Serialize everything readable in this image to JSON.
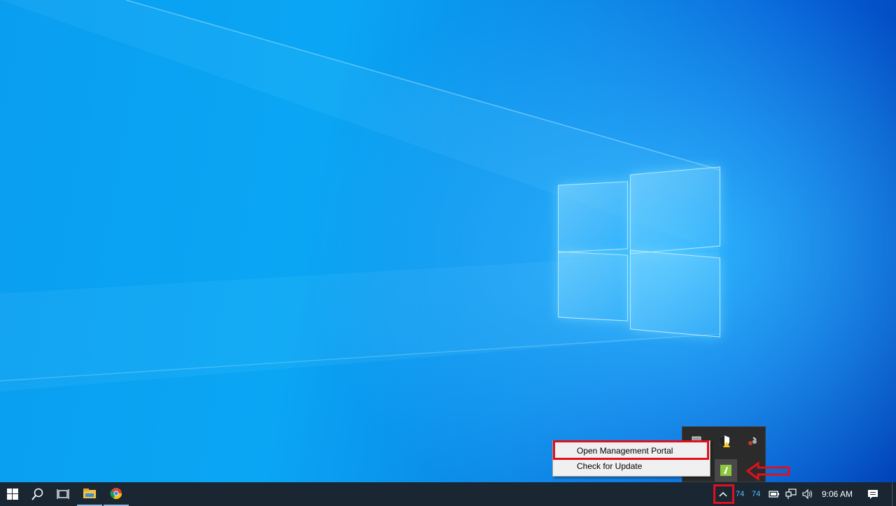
{
  "context_menu": {
    "items": [
      {
        "label": "Open Management Portal"
      },
      {
        "label": "Check for Update"
      }
    ]
  },
  "system_tray": {
    "cpu_temp": "74",
    "gpu_temp": "74",
    "clock": "9:06 AM"
  },
  "taskbar": {
    "pinned": [
      "windows-start-icon",
      "search-icon",
      "task-view-icon",
      "file-explorer-icon",
      "chrome-icon"
    ]
  },
  "colors": {
    "annotation_red": "#e0101c",
    "taskbar_bg": "#1a2733",
    "temp_text": "#4ec3ff"
  }
}
